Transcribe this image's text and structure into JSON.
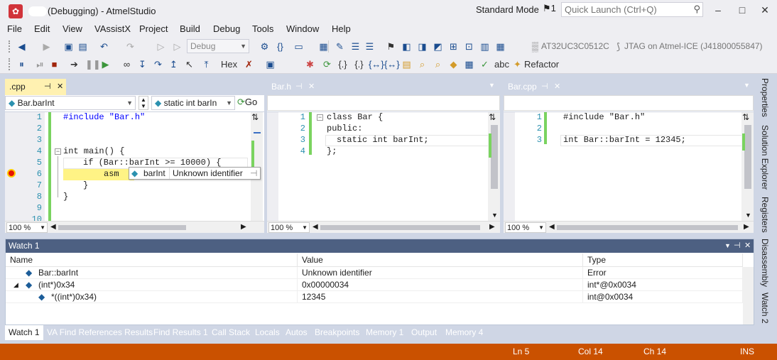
{
  "window": {
    "title": "(Debugging) - AtmelStudio",
    "mode": "Standard Mode",
    "flag_count": "1",
    "quick_launch_placeholder": "Quick Launch (Ctrl+Q)"
  },
  "menu": [
    "File",
    "Edit",
    "View",
    "VAssistX",
    "Project",
    "Build",
    "Debug",
    "Tools",
    "Window",
    "Help"
  ],
  "toolbar": {
    "config": "Debug",
    "device": "AT32UC3C0512C",
    "tool": "JTAG on Atmel-ICE (J41800055847)",
    "hex_label": "Hex",
    "refactor_label": "Refactor"
  },
  "editors": [
    {
      "tab": ".cpp",
      "nav_scope": "Bar.barInt",
      "nav_member": "static int barIn",
      "go_label": "Go",
      "zoom": "100 %",
      "line_numbers": [
        "1",
        "2",
        "3",
        "4",
        "5",
        "6",
        "7",
        "8",
        "9",
        "10"
      ],
      "code": [
        "#include \"Bar.h\"",
        "",
        "",
        "int main() {",
        "if (Bar::barInt >= 10000) {",
        "asm",
        "}",
        "}"
      ]
    },
    {
      "tab": "Bar.h",
      "zoom": "100 %",
      "line_numbers": [
        "1",
        "2",
        "3",
        "4"
      ],
      "code": [
        "class Bar {",
        "public:",
        "static int barInt;",
        "};"
      ]
    },
    {
      "tab": "Bar.cpp",
      "zoom": "100 %",
      "line_numbers": [
        "1",
        "2",
        "3"
      ],
      "code": [
        "#include \"Bar.h\"",
        "",
        "int Bar::barInt = 12345;"
      ]
    }
  ],
  "tooltip": {
    "name": "barInt",
    "value": "Unknown identifier"
  },
  "watch": {
    "title": "Watch 1",
    "columns": [
      "Name",
      "Value",
      "Type"
    ],
    "rows": [
      {
        "name": "Bar::barInt",
        "value": "Unknown identifier",
        "type": "Error"
      },
      {
        "name": "(int*)0x34",
        "value": "0x00000034",
        "type": "int*@0x0034"
      },
      {
        "name": "*((int*)0x34)",
        "value": "12345",
        "type": "int@0x0034"
      }
    ]
  },
  "bottom_tabs": [
    "Watch 1",
    "VA Find References Results",
    "Find Results 1",
    "Call Stack",
    "Locals",
    "Autos",
    "Breakpoints",
    "Memory 1",
    "Output",
    "Memory 4"
  ],
  "side_tabs": [
    "Properties",
    "Solution Explorer",
    "Registers",
    "Disassembly",
    "Watch 2"
  ],
  "status": {
    "line": "Ln 5",
    "col": "Col 14",
    "ch": "Ch 14",
    "mode": "INS"
  },
  "colors": {
    "frame": "#cfd6e5",
    "active_tab": "#fff1b1",
    "status_bar": "#ca5100",
    "tool_header": "#4d6082",
    "keyword": "#0000ff",
    "string": "#a31515",
    "type": "#2b91af",
    "line_number": "#2b91af"
  }
}
